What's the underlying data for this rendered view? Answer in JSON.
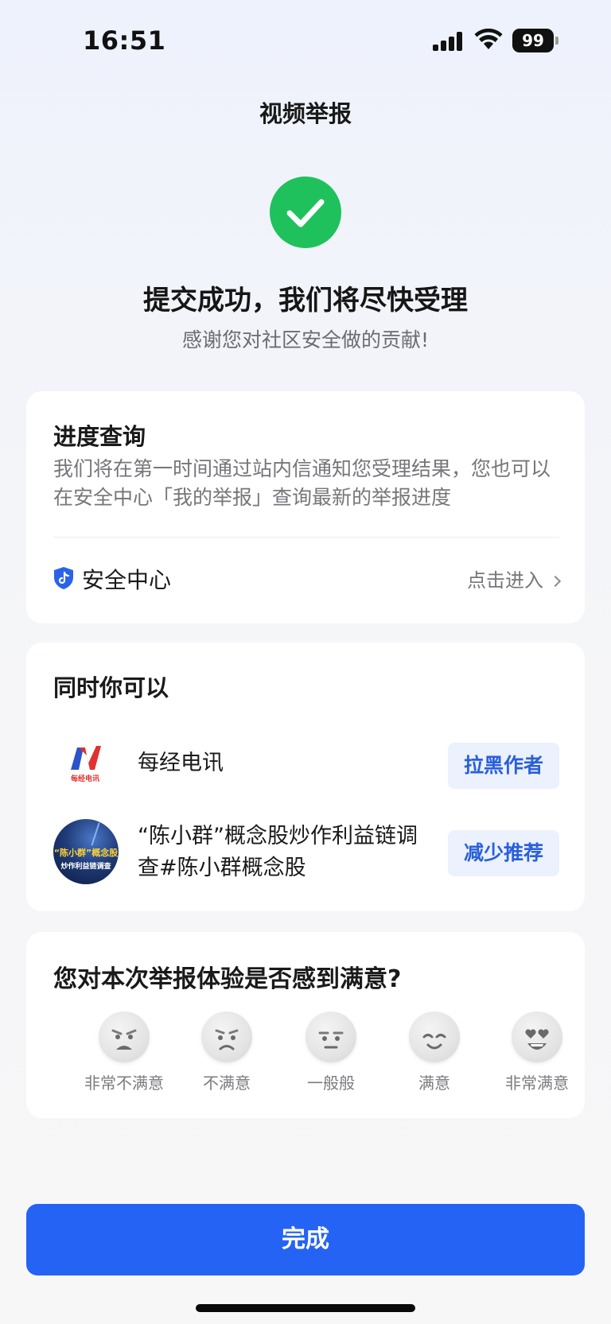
{
  "status_bar": {
    "time": "16:51",
    "battery": "99"
  },
  "header": {
    "title": "视频举报"
  },
  "success": {
    "title": "提交成功，我们将尽快受理",
    "subtitle": "感谢您对社区安全做的贡献!"
  },
  "progress_card": {
    "title": "进度查询",
    "description": "我们将在第一时间通过站内信通知您受理结果，您也可以在安全中心「我的举报」查询最新的举报进度",
    "security_center_label": "安全中心",
    "enter_label": "点击进入"
  },
  "actions_card": {
    "title": "同时你可以",
    "items": [
      {
        "text": "每经电讯",
        "button": "拉黑作者",
        "icon": "meijing-logo",
        "logo_text": "每经电讯"
      },
      {
        "text": "“陈小群”概念股炒作利益链调查#陈小群概念股",
        "button": "减少推荐",
        "icon": "video-thumbnail",
        "thumb_line1": "“陈小群”概念股",
        "thumb_line2": "炒作利益链调查"
      }
    ]
  },
  "survey_card": {
    "title": "您对本次举报体验是否感到满意?",
    "options": [
      {
        "label": "非常不满意",
        "icon": "very-dissatisfied-face-icon"
      },
      {
        "label": "不满意",
        "icon": "dissatisfied-face-icon"
      },
      {
        "label": "一般般",
        "icon": "neutral-face-icon"
      },
      {
        "label": "满意",
        "icon": "satisfied-face-icon"
      },
      {
        "label": "非常满意",
        "icon": "very-satisfied-face-icon"
      }
    ]
  },
  "footer": {
    "done_label": "完成"
  },
  "colors": {
    "accent": "#2563f5",
    "success": "#1fc15c",
    "pill_bg": "#ebf1fd",
    "pill_text": "#2a5fdc"
  }
}
